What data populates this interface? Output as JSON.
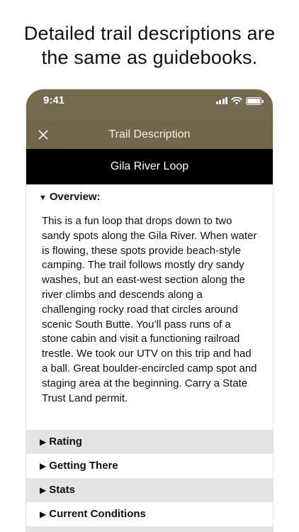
{
  "headline": {
    "line1": "Detailed trail descriptions are",
    "line2": "the same as guidebooks."
  },
  "status_bar": {
    "time": "9:41",
    "icons": [
      "signal-icon",
      "wifi-icon",
      "battery-icon"
    ]
  },
  "nav": {
    "close_icon": "close-icon",
    "title": "Trail Description"
  },
  "trail": {
    "name": "Gila River Loop"
  },
  "overview": {
    "label": "Overview:",
    "expanded": true,
    "text": "This is a fun loop that drops down to two sandy spots along the Gila River. When water is flowing, these spots provide beach-style camping. The trail follows mostly dry sandy washes, but an east-west section along the river climbs and descends along a challenging rocky road that circles around scenic South Butte. You’ll pass runs of a stone cabin and visit a functioning railroad trestle. We took our UTV on this trip and had a ball. Great boulder-encircled camp spot and staging area at the beginning. Carry a State Trust Land permit."
  },
  "sections": [
    {
      "label": "Rating"
    },
    {
      "label": "Getting There"
    },
    {
      "label": "Stats"
    },
    {
      "label": "Current Conditions"
    }
  ],
  "colors": {
    "status_bar": "#736a4f",
    "nav_bar": "#74664a",
    "trail_header": "#000000",
    "section_shade": "#e4e4e4"
  }
}
